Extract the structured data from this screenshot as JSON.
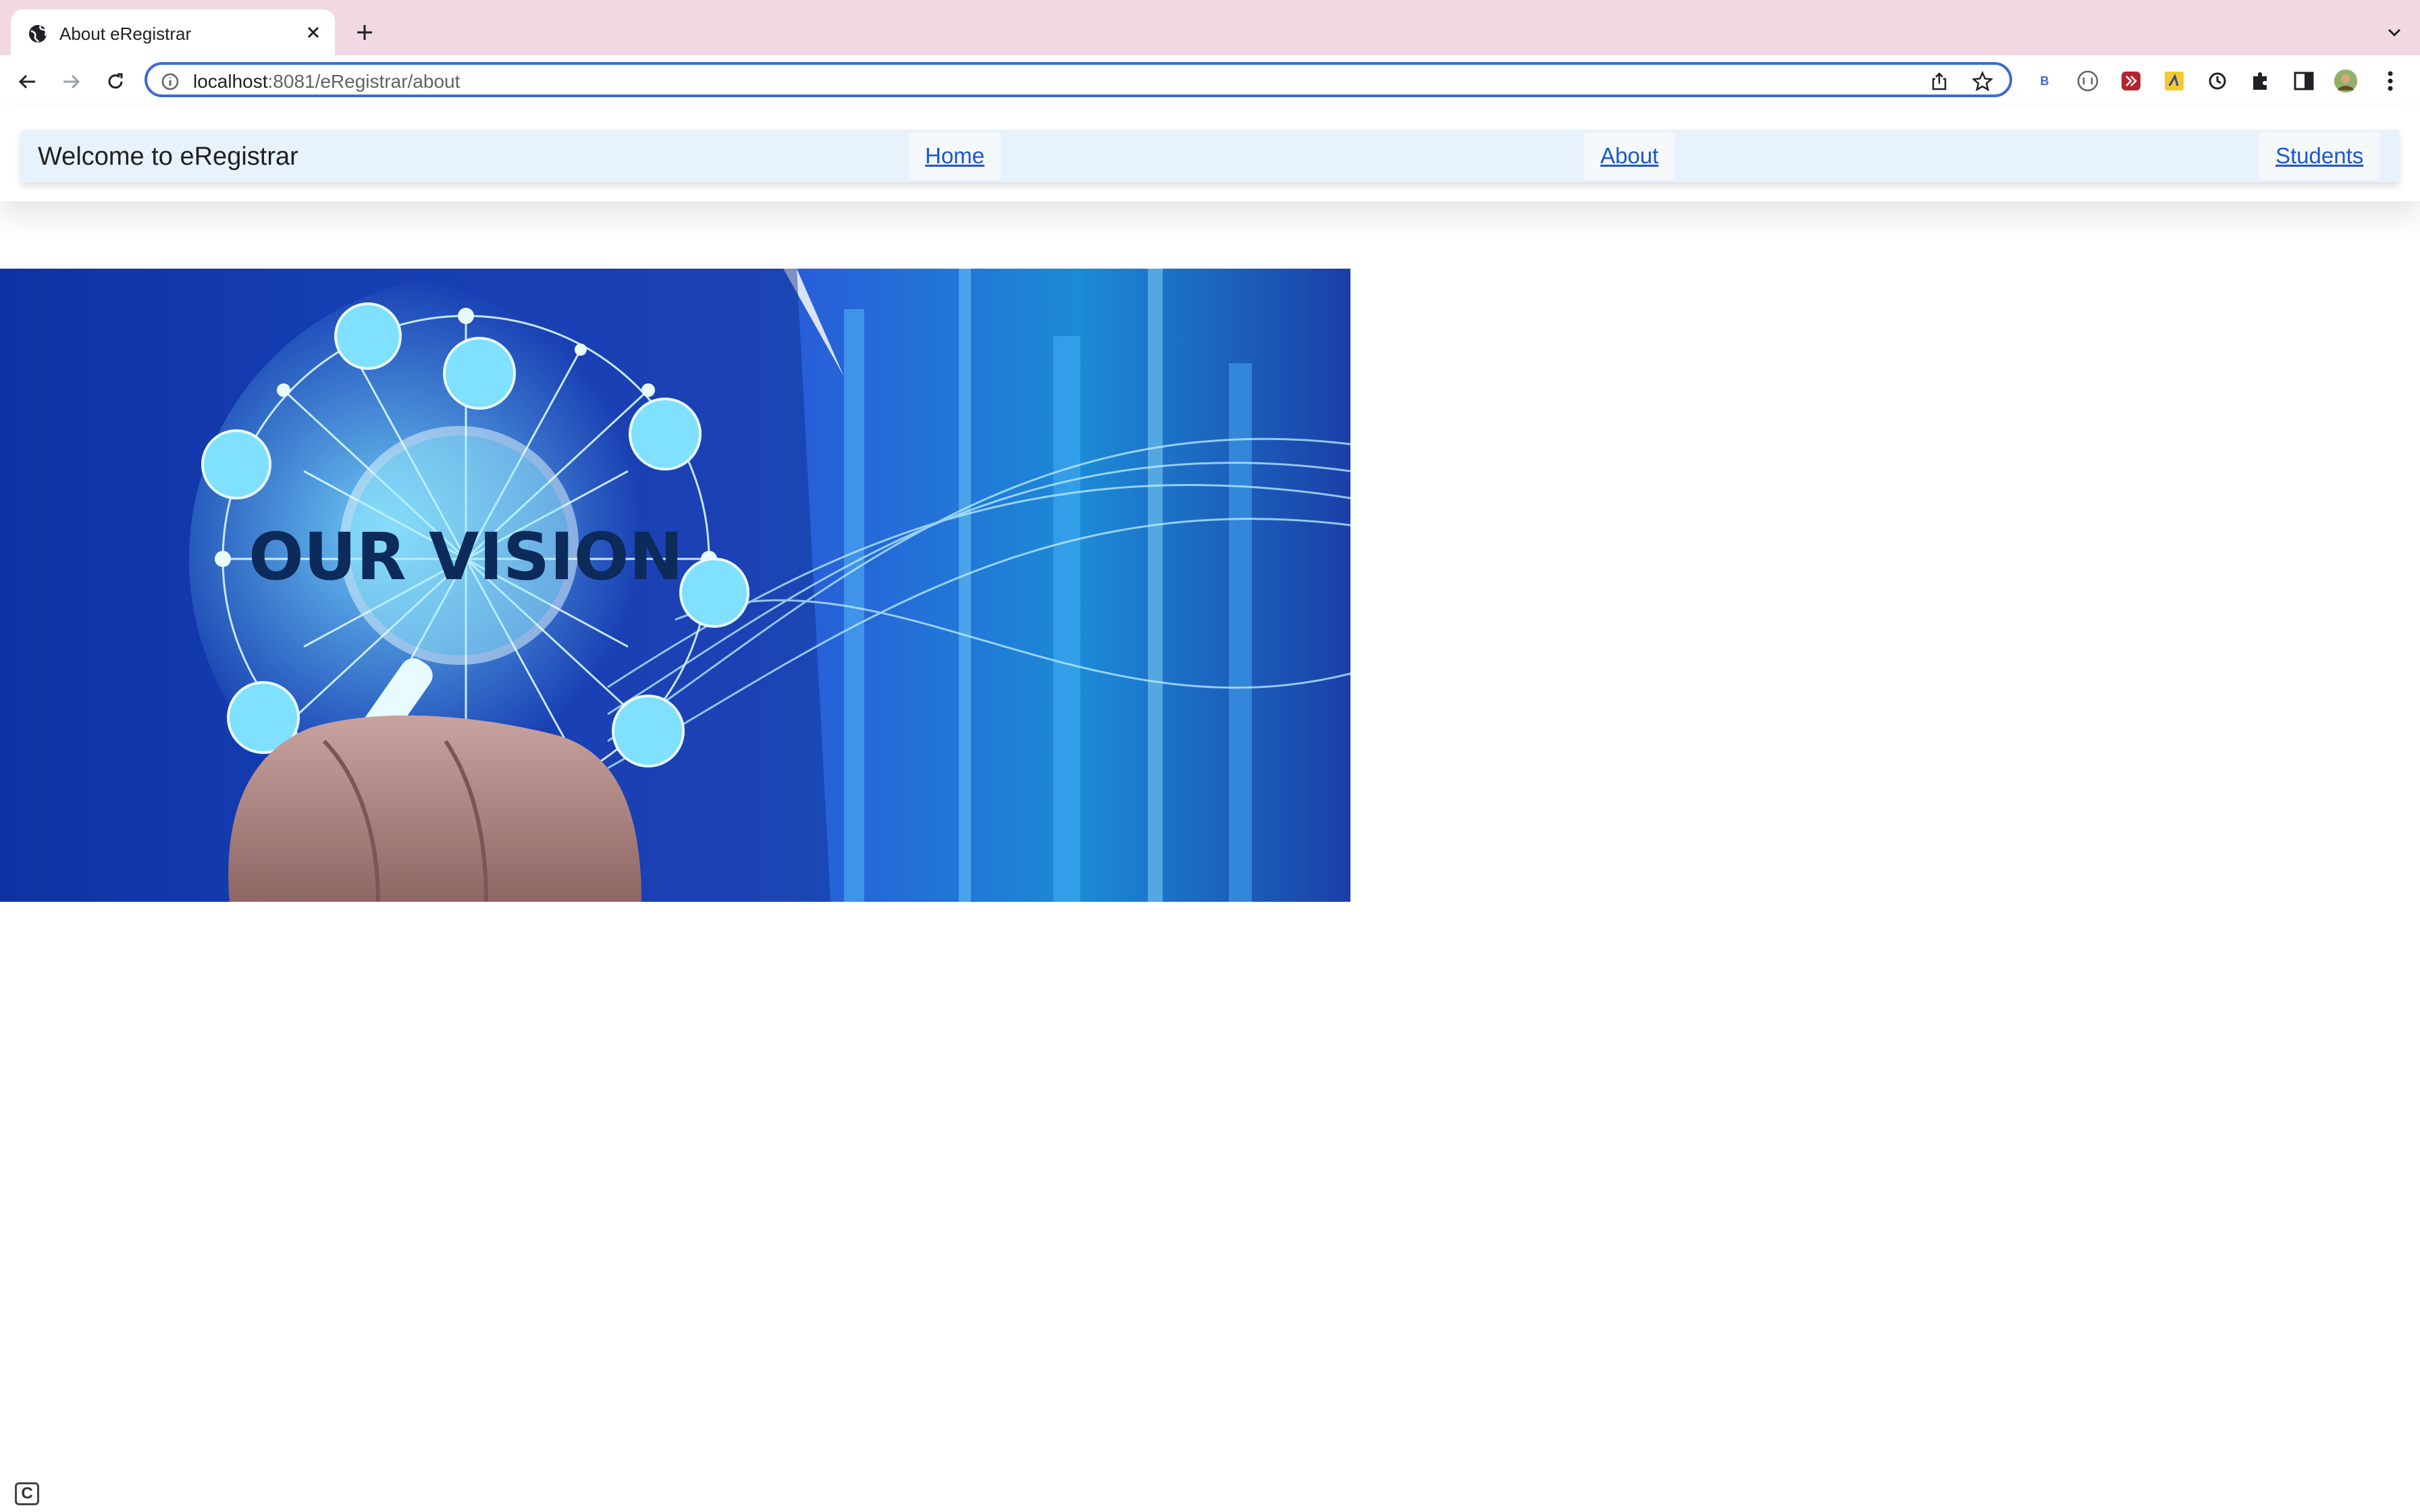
{
  "browser": {
    "tab_title": "About eRegistrar",
    "url_host": "localhost",
    "url_rest": ":8081/eRegistrar/about",
    "extension_b_label": "B"
  },
  "site": {
    "brand": "Welcome to eRegistrar",
    "nav": [
      {
        "label": "Home"
      },
      {
        "label": "About"
      },
      {
        "label": "Students"
      }
    ]
  },
  "hero": {
    "headline": "OUR VISION"
  },
  "colors": {
    "tabstrip": "#f1d8e3",
    "nav_background": "#e8f2fc",
    "link": "#1a57d2",
    "omnibox_focus": "#3c6bd4"
  },
  "icons": [
    "globe-icon",
    "close-icon",
    "plus-icon",
    "chevron-down-icon",
    "back-arrow-icon",
    "forward-arrow-icon",
    "reload-icon",
    "info-icon",
    "share-icon",
    "star-icon",
    "puzzle-icon",
    "sidepanel-icon",
    "avatar",
    "kebab-menu-icon"
  ]
}
